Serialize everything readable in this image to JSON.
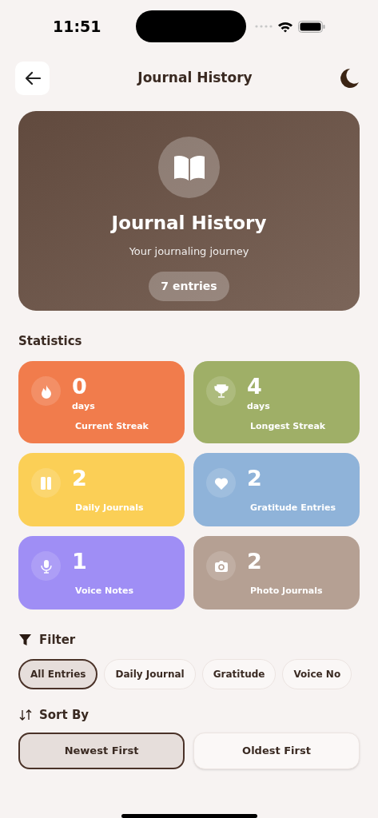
{
  "status_bar": {
    "time": "11:51"
  },
  "header": {
    "title": "Journal History"
  },
  "hero": {
    "title": "Journal History",
    "subtitle": "Your journaling journey",
    "badge": "7 entries"
  },
  "statistics": {
    "title": "Statistics",
    "cards": [
      {
        "kind": "current_streak",
        "value": "0",
        "unit": "days",
        "label": "Current Streak",
        "color": "#f17c4c"
      },
      {
        "kind": "longest_streak",
        "value": "4",
        "unit": "days",
        "label": "Longest Streak",
        "color": "#9faf67"
      },
      {
        "kind": "daily",
        "value": "2",
        "label": "Daily Journals",
        "color": "#fbcf56"
      },
      {
        "kind": "gratitude",
        "value": "2",
        "label": "Gratitude Entries",
        "color": "#8fb3d9"
      },
      {
        "kind": "voice",
        "value": "1",
        "label": "Voice Notes",
        "color": "#9f8ef5"
      },
      {
        "kind": "photo",
        "value": "2",
        "label": "Photo Journals",
        "color": "#b5a093"
      }
    ]
  },
  "filter": {
    "title": "Filter",
    "chips": [
      {
        "label": "All Entries",
        "selected": true
      },
      {
        "label": "Daily Journal",
        "selected": false
      },
      {
        "label": "Gratitude",
        "selected": false
      },
      {
        "label": "Voice No",
        "selected": false
      }
    ]
  },
  "sort": {
    "title": "Sort By",
    "options": [
      {
        "label": "Newest First",
        "selected": true
      },
      {
        "label": "Oldest First",
        "selected": false
      }
    ]
  }
}
